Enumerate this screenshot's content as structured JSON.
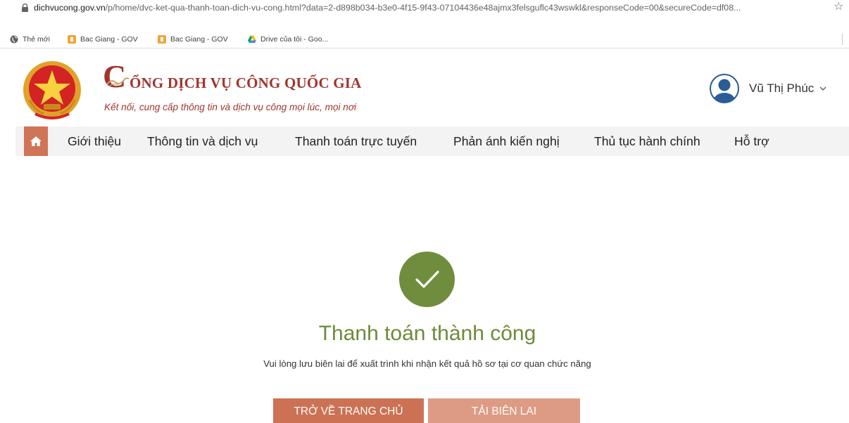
{
  "browser": {
    "url_host": "dichvucong.gov.vn",
    "url_path": "/p/home/dvc-ket-qua-thanh-toan-dich-vu-cong.html?data=2-d898b034-b3e0-4f15-9f43-07104436e48ajmx3felsguflc43wswkl&responseCode=00&secureCode=df08..."
  },
  "bookmarks": [
    {
      "label": "Thẻ mới",
      "icon": "globe-icon"
    },
    {
      "label": "Bac Giang - GOV",
      "icon": "bookmark-site-icon"
    },
    {
      "label": "Bac Giang - GOV",
      "icon": "bookmark-site-icon"
    },
    {
      "label": "Drive của tôi - Goo...",
      "icon": "google-drive-icon"
    }
  ],
  "header": {
    "title_initial": "C",
    "title_rest": "ỔNG DỊCH VỤ CÔNG QUỐC GIA",
    "slogan": "Kết nối, cung cấp thông tin và dịch vụ công mọi lúc, mọi nơi",
    "user_name": "Vũ Thị Phúc"
  },
  "nav": {
    "items": [
      {
        "label": "Giới thiệu"
      },
      {
        "label": "Thông tin và dịch vụ"
      },
      {
        "label": "Thanh toán trực tuyến"
      },
      {
        "label": "Phản ánh kiến nghị"
      },
      {
        "label": "Thủ tục hành chính"
      },
      {
        "label": "Hỗ trợ"
      }
    ]
  },
  "result": {
    "title": "Thanh toán thành công",
    "message": "Vui lòng lưu biên lai để xuất trình khi nhận kết quả hồ sơ tại cơ quan chức năng",
    "home_button": "TRỞ VỀ TRANG CHỦ",
    "receipt_button": "TẢI BIÊN LAI"
  },
  "colors": {
    "brand_red": "#a1352e",
    "nav_home": "#cf7456",
    "success_green": "#6e8a3a",
    "button_primary": "#cc7153",
    "button_secondary": "#de9b83"
  }
}
